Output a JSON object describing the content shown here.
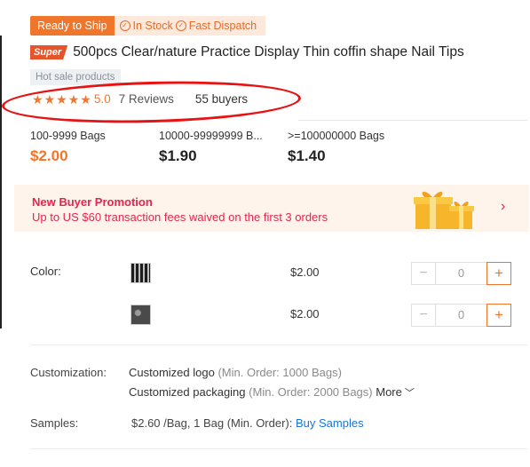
{
  "badges": {
    "ready": "Ready to Ship",
    "in_stock": "In Stock",
    "fast_dispatch": "Fast Dispatch"
  },
  "product": {
    "super_tag": "Super",
    "title": "500pcs Clear/nature Practice Display Thin coffin shape Nail Tips",
    "hot_tag": "Hot sale products"
  },
  "rating": {
    "stars": 5,
    "score": "5.0",
    "reviews": "7 Reviews",
    "buyers": "55 buyers"
  },
  "tiers": [
    {
      "range": "100-9999 Bags",
      "price": "$2.00"
    },
    {
      "range": "10000-99999999 B...",
      "price": "$1.90"
    },
    {
      "range": ">=100000000 Bags",
      "price": "$1.40"
    }
  ],
  "promo": {
    "title": "New Buyer Promotion",
    "desc": "Up to US $60 transaction fees waived on the first 3 orders"
  },
  "color": {
    "label": "Color:",
    "options": [
      {
        "price": "$2.00",
        "qty": "0"
      },
      {
        "price": "$2.00",
        "qty": "0"
      }
    ]
  },
  "customization": {
    "label": "Customization:",
    "logo": "Customized logo",
    "logo_moq": "(Min. Order: 1000 Bags)",
    "packaging": "Customized packaging",
    "packaging_moq": "(Min. Order: 2000 Bags)",
    "more": "More"
  },
  "samples": {
    "label": "Samples:",
    "text": "$2.60 /Bag, 1 Bag (Min. Order):",
    "link": "Buy Samples"
  },
  "colors": {
    "accent": "#f0762c",
    "promo": "#e5254d",
    "annotation": "#e81212",
    "link": "#1a73d9"
  }
}
